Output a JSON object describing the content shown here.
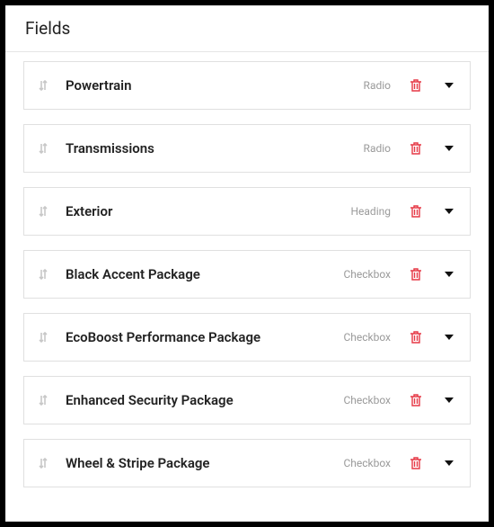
{
  "header": {
    "title": "Fields"
  },
  "fields": [
    {
      "label": "Powertrain",
      "type": "Radio"
    },
    {
      "label": "Transmissions",
      "type": "Radio"
    },
    {
      "label": "Exterior",
      "type": "Heading"
    },
    {
      "label": "Black Accent Package",
      "type": "Checkbox"
    },
    {
      "label": "EcoBoost Performance Package",
      "type": "Checkbox"
    },
    {
      "label": "Enhanced Security Package",
      "type": "Checkbox"
    },
    {
      "label": "Wheel & Stripe Package",
      "type": "Checkbox"
    }
  ]
}
